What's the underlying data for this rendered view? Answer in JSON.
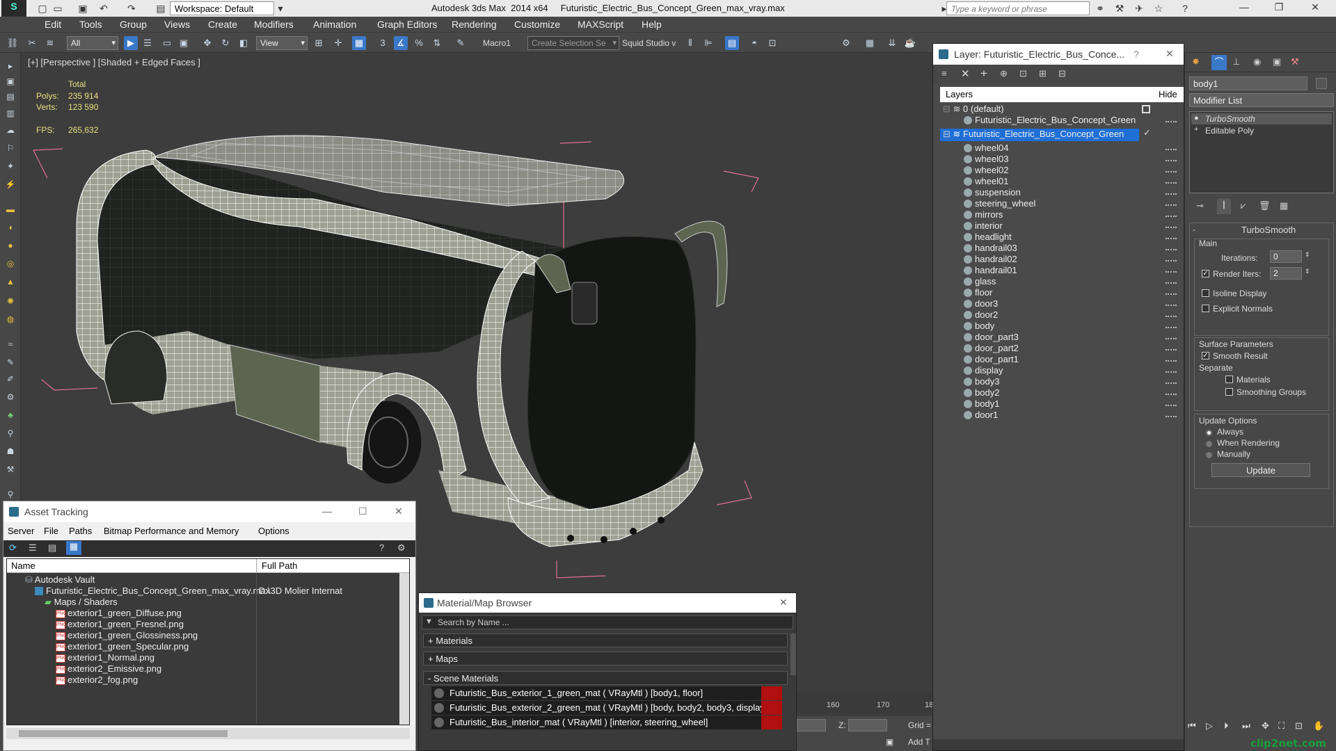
{
  "app": {
    "title": "Autodesk 3ds Max  2014 x64     Futuristic_Electric_Bus_Concept_Green_max_vray.max",
    "workspace": "Workspace: Default",
    "search_placeholder": "Type a keyword or phrase"
  },
  "menu": [
    "Edit",
    "Tools",
    "Group",
    "Views",
    "Create",
    "Modifiers",
    "Animation",
    "Graph Editors",
    "Rendering",
    "Customize",
    "MAXScript",
    "Help"
  ],
  "toolbar": {
    "filter": "All",
    "ref_coord": "View",
    "macro_label": "Macro1",
    "selection_set": "Create Selection Se",
    "squid": "Squid Studio v"
  },
  "viewport": {
    "label": "[+] [Perspective ] [Shaded + Edged Faces ]",
    "stats": {
      "total_label": "Total",
      "polys_label": "Polys:",
      "polys_value": "235 914",
      "verts_label": "Verts:",
      "verts_value": "123 590",
      "fps_label": "FPS:",
      "fps_value": "265,632"
    }
  },
  "asset_tracking": {
    "title": "Asset Tracking",
    "menus": [
      "Server",
      "File",
      "Paths",
      "Bitmap Performance and Memory",
      "Options"
    ],
    "columns": [
      "Name",
      "Full Path"
    ],
    "rows": [
      {
        "name": "Autodesk Vault",
        "path": ""
      },
      {
        "name": "Futuristic_Electric_Bus_Concept_Green_max_vray.max",
        "path": "D:\\3D Molier Internat"
      },
      {
        "name": "Maps / Shaders",
        "path": ""
      },
      {
        "name": "exterior1_green_Diffuse.png",
        "path": ""
      },
      {
        "name": "exterior1_green_Fresnel.png",
        "path": ""
      },
      {
        "name": "exterior1_green_Glossiness.png",
        "path": ""
      },
      {
        "name": "exterior1_green_Specular.png",
        "path": ""
      },
      {
        "name": "exterior1_Normal.png",
        "path": ""
      },
      {
        "name": "exterior2_Emissive.png",
        "path": ""
      },
      {
        "name": "exterior2_fog.png",
        "path": ""
      }
    ]
  },
  "material_browser": {
    "title": "Material/Map Browser",
    "search_placeholder": "Search by Name ...",
    "sections": [
      "+ Materials",
      "+ Maps",
      "- Scene Materials"
    ],
    "materials": [
      "Futuristic_Bus_exterior_1_green_mat  ( VRayMtl )  [body1, floor]",
      "Futuristic_Bus_exterior_2_green_mat  ( VRayMtl )  [body, body2, body3, display,...",
      "Futuristic_Bus_interior_mat  ( VRayMtl )  [interior, steering_wheel]"
    ]
  },
  "layer_explorer": {
    "title": "Layer: Futuristic_Electric_Bus_Conce...",
    "columns": [
      "Layers",
      "Hide"
    ],
    "default_layer": "0 (default)",
    "default_child": "Futuristic_Electric_Bus_Concept_Green",
    "selected_layer": "Futuristic_Electric_Bus_Concept_Green",
    "objects": [
      "wheel04",
      "wheel03",
      "wheel02",
      "wheel01",
      "suspension",
      "steering_wheel",
      "mirrors",
      "interior",
      "headlight",
      "handrail03",
      "handrail02",
      "handrail01",
      "glass",
      "floor",
      "door3",
      "door2",
      "body",
      "door_part3",
      "door_part2",
      "door_part1",
      "display",
      "body3",
      "body2",
      "body1",
      "door1"
    ]
  },
  "command_panel": {
    "object_name": "body1",
    "modifier_list": "Modifier List",
    "stack": [
      "TurboSmooth",
      "Editable Poly"
    ],
    "rollout_title": "TurboSmooth",
    "main_label": "Main",
    "iterations_label": "Iterations:",
    "iterations_value": "0",
    "render_iters_label": "Render Iters:",
    "render_iters_value": "2",
    "isoline_label": "Isoline Display",
    "explicit_normals_label": "Explicit Normals",
    "surface_params_label": "Surface Parameters",
    "smooth_result_label": "Smooth Result",
    "separate_label": "Separate",
    "materials_label": "Materials",
    "smoothing_groups_label": "Smoothing Groups",
    "update_options_label": "Update Options",
    "always_label": "Always",
    "when_rendering_label": "When Rendering",
    "manually_label": "Manually",
    "update_button": "Update"
  },
  "timeline": {
    "ticks": [
      "160",
      "170",
      "18"
    ],
    "z_label": "Z:",
    "grid_label": "Grid =",
    "add_label": "Add T"
  },
  "watermark": "clip2net.com",
  "colors": {
    "selection_blue": "#3a78c8",
    "wire_white": "#f2f2f2",
    "bus_green_dark": "#2c3126",
    "bbox_pink": "#e07090",
    "material_red": "#b01010"
  }
}
